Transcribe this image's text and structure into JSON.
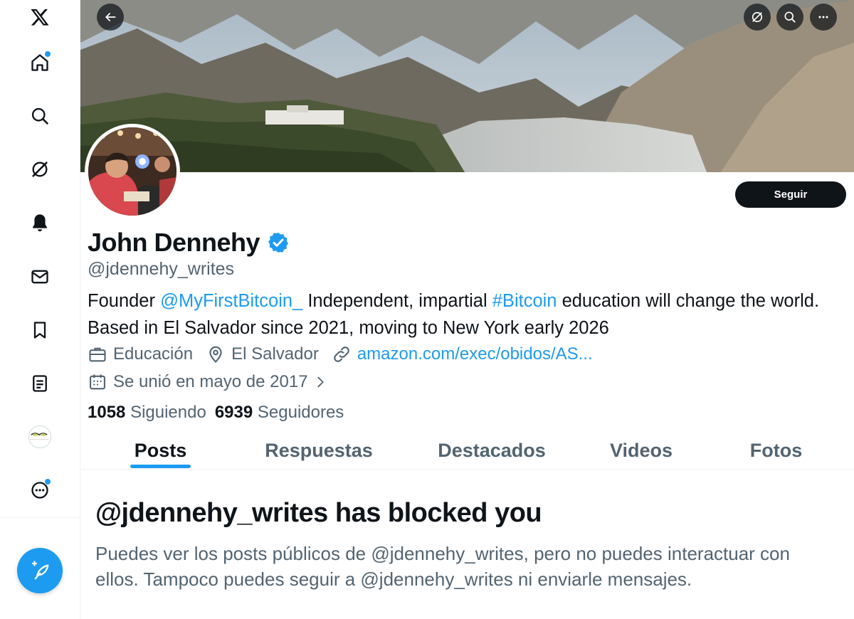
{
  "sidebar": {
    "logo_icon": "x-logo-icon",
    "items": [
      {
        "name": "home",
        "icon": "home-icon",
        "has_badge": true
      },
      {
        "name": "explore",
        "icon": "search-icon",
        "has_badge": false
      },
      {
        "name": "grok",
        "icon": "grok-icon",
        "has_badge": false
      },
      {
        "name": "notifications",
        "icon": "bell-icon",
        "has_badge": false
      },
      {
        "name": "messages",
        "icon": "mail-icon",
        "has_badge": false
      },
      {
        "name": "bookmarks",
        "icon": "bookmark-icon",
        "has_badge": false
      },
      {
        "name": "lists",
        "icon": "list-icon",
        "has_badge": false
      },
      {
        "name": "profile",
        "icon": "avatar-icon",
        "has_badge": false
      },
      {
        "name": "more",
        "icon": "more-circle-icon",
        "has_badge": true
      }
    ],
    "compose_icon": "compose-post-icon"
  },
  "header": {
    "back_icon": "arrow-left-icon",
    "grok_icon": "grok-icon",
    "search_icon": "search-icon",
    "more_icon": "more-horizontal-icon"
  },
  "profile": {
    "display_name": "John Dennehy",
    "verified_icon": "verified-badge-icon",
    "handle": "@jdennehy_writes",
    "follow_label": "Seguir",
    "bio": {
      "part1": "Founder ",
      "mention": "@MyFirstBitcoin_",
      "part2": " Independent, impartial ",
      "hashtag": "#Bitcoin",
      "part3": " education will change the world. Based in El Salvador since 2021, moving to New York early 2026"
    },
    "category": "Educación",
    "location": "El Salvador",
    "website": "amazon.com/exec/obidos/AS...",
    "joined": "Se unió en mayo de 2017",
    "following_count": "1058",
    "following_label": "Siguiendo",
    "followers_count": "6939",
    "followers_label": "Seguidores"
  },
  "tabs": [
    {
      "label": "Posts",
      "active": true
    },
    {
      "label": "Respuestas",
      "active": false
    },
    {
      "label": "Destacados",
      "active": false
    },
    {
      "label": "Videos",
      "active": false
    },
    {
      "label": "Fotos",
      "active": false
    }
  ],
  "blocked": {
    "title": "@jdennehy_writes has blocked you",
    "message": "Puedes ver los posts públicos de @jdennehy_writes, pero no puedes interactuar con ellos. Tampoco puedes seguir a @jdennehy_writes ni enviarle mensajes."
  },
  "colors": {
    "accent": "#1d9bf0",
    "text_primary": "#0f1419",
    "text_secondary": "#536471",
    "border": "#eff3f4"
  }
}
